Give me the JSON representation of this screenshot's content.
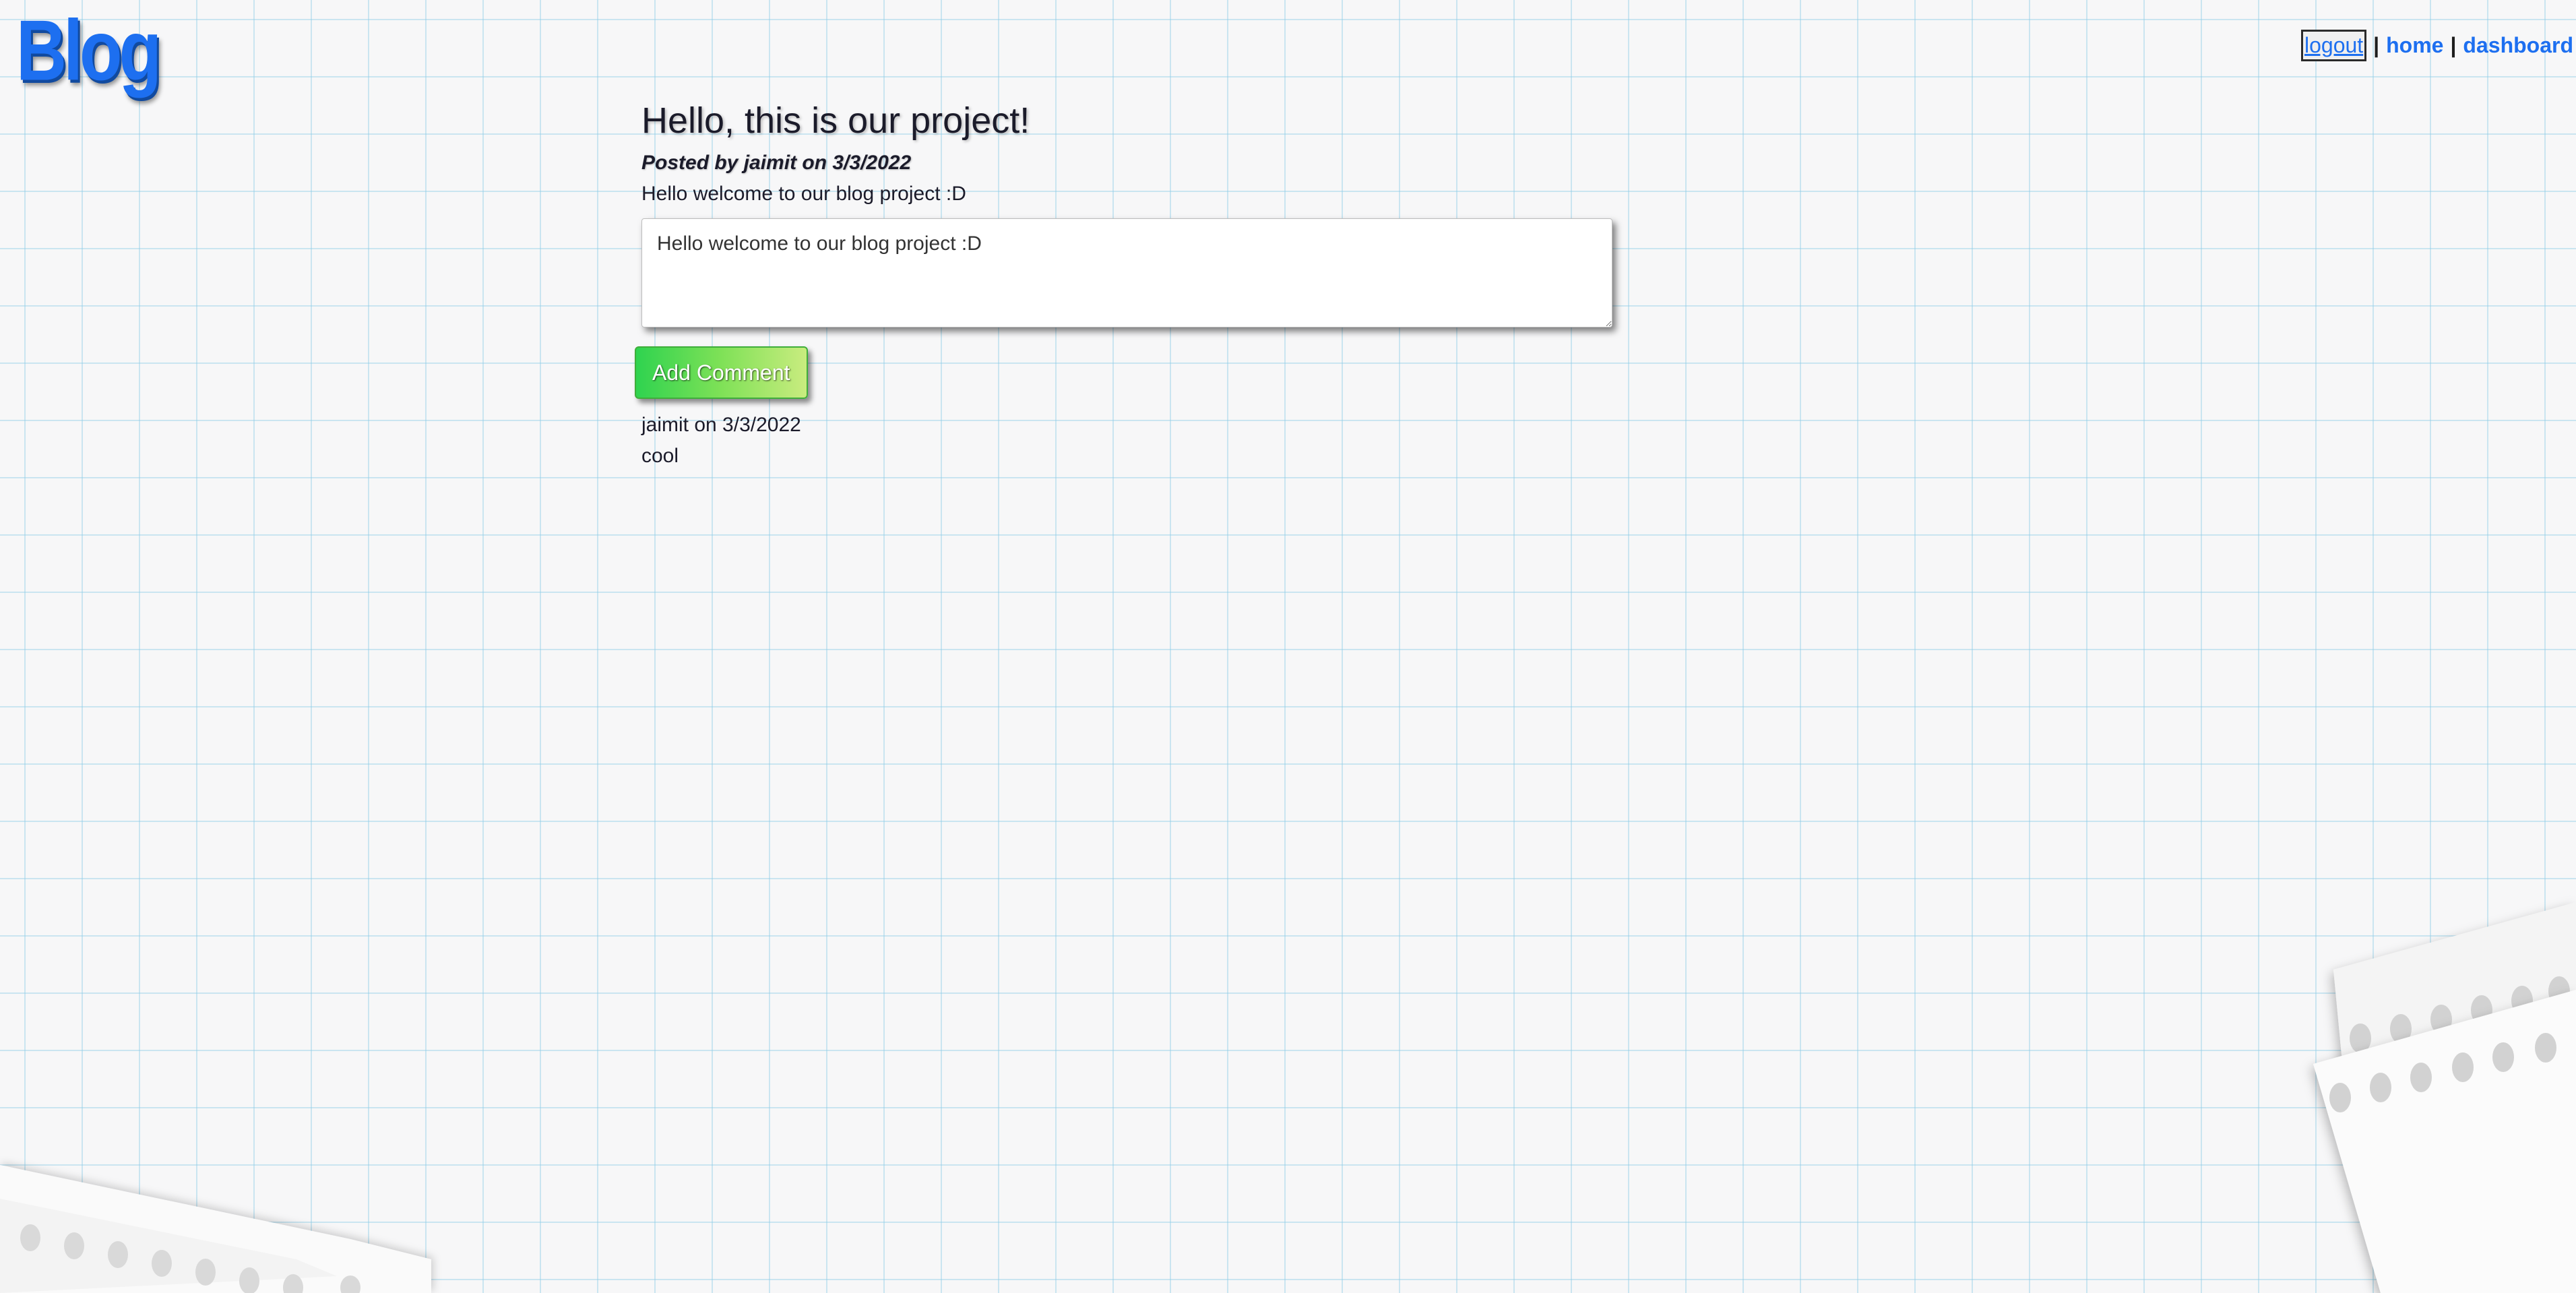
{
  "app": {
    "logo": "Blog"
  },
  "nav": {
    "logout_label": "logout",
    "separator": "|",
    "home_label": "home",
    "dashboard_label": "dashboard"
  },
  "post": {
    "title": "Hello, this is our project!",
    "meta": "Posted by jaimit on 3/3/2022",
    "body": "Hello welcome to our blog project :D"
  },
  "comment_form": {
    "input_value": "Hello welcome to our blog project :D",
    "submit_label": "Add Comment"
  },
  "comments": [
    {
      "meta": "jaimit on 3/3/2022",
      "text": "cool"
    }
  ],
  "colors": {
    "accent": "#1d6ff0",
    "button_start": "#2fd34f",
    "button_end": "#c9ec7f",
    "grid": "#92cee8",
    "background": "#f7f7f8"
  }
}
